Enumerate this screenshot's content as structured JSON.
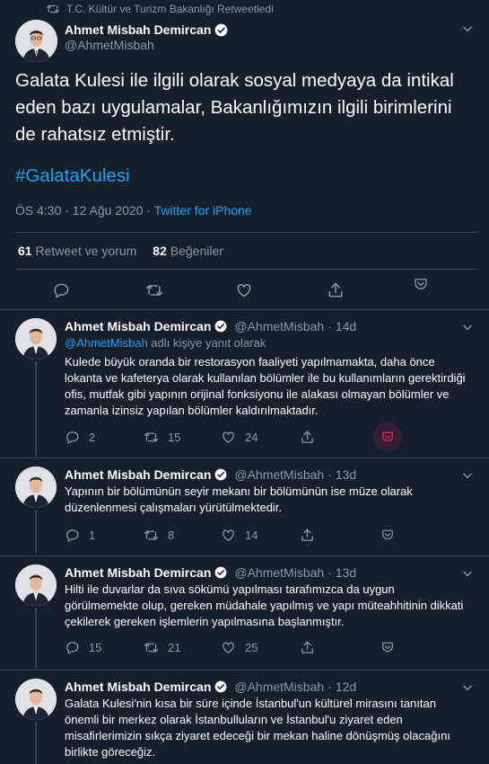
{
  "retweet_header": "T.C. Kültür ve Turizm Bakanlığı Retweetledi",
  "main_tweet": {
    "name": "Ahmet Misbah Demircan",
    "handle": "@AhmetMisbah",
    "text": "Galata Kulesi ile ilgili olarak sosyal medyaya da intikal eden bazı uygulamalar, Bakanlığımızın ilgili birimlerini de rahatsız etmiştir.",
    "hashtag": "#GalataKulesi",
    "time": "ÖS 4:30 · 12 Ağu 2020",
    "source": "Twitter for iPhone",
    "retweets_count": "61",
    "retweets_label": "Retweet ve yorum",
    "likes_count": "82",
    "likes_label": "Beğeniler"
  },
  "replies": [
    {
      "name": "Ahmet Misbah Demircan",
      "handle": "@AhmetMisbah",
      "date": "14d",
      "reply_to_handle": "@AhmetMisbah",
      "reply_to_suffix": " adlı kişiye yanıt olarak",
      "text": "Kulede büyük oranda bir restorasyon faaliyeti yapılmamakta, daha önce lokanta ve kafeterya olarak kullanılan bölümler ile bu kullanımların gerektirdiği ofis, mutfak gibi yapının orijinal fonksiyonu ile alakası olmayan bölümler ve zamanla izinsiz yapılan bölümler kaldırılmaktadır.",
      "replies": "2",
      "retweets": "15",
      "likes": "24"
    },
    {
      "name": "Ahmet Misbah Demircan",
      "handle": "@AhmetMisbah",
      "date": "13d",
      "text": "Yapının bir bölümünün seyir mekanı bir bölümünün ise müze olarak düzenlenmesi çalışmaları yürütülmektedir.",
      "replies": "1",
      "retweets": "8",
      "likes": "14"
    },
    {
      "name": "Ahmet Misbah Demircan",
      "handle": "@AhmetMisbah",
      "date": "13d",
      "text": "Hilti ile duvarlar da sıva sökümü yapılması tarafımızca da uygun görülmemekte olup, gereken müdahale yapılmış ve yapı müteahhitinin dikkati çekilerek gereken işlemlerin yapılmasına başlanmıştır.",
      "replies": "15",
      "retweets": "21",
      "likes": "25"
    },
    {
      "name": "Ahmet Misbah Demircan",
      "handle": "@AhmetMisbah",
      "date": "12d",
      "text": "Galata Kulesi'nin kısa bir süre içinde İstanbul'un kültürel mirasını tanıtan önemli bir merkez olarak İstanbulluların ve İstanbul'u ziyaret eden misafirlerimizin sıkça ziyaret edeceği bir mekan haline dönüşmüş olacağını birlikte göreceğiz."
    }
  ],
  "colors": {
    "background": "#15202b",
    "accent": "#1da1f2",
    "muted": "#8899a6",
    "divider": "#38444d",
    "highlight": "#e0245e"
  }
}
